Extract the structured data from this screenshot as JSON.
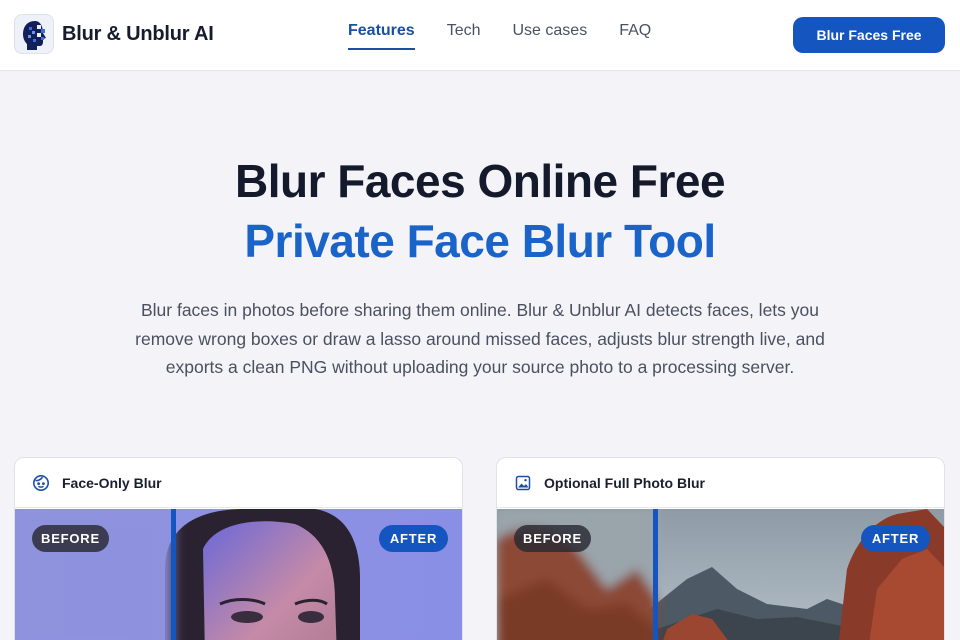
{
  "header": {
    "brand_name": "Blur & Unblur AI",
    "nav": [
      "Features",
      "Tech",
      "Use cases",
      "FAQ"
    ],
    "active_nav": "Features",
    "cta_label": "Blur Faces Free"
  },
  "hero": {
    "title": "Blur Faces Online Free",
    "subtitle": "Private Face Blur Tool",
    "description": "Blur faces in photos before sharing them online. Blur & Unblur AI detects faces, lets you remove wrong boxes or draw a lasso around missed faces, adjusts blur strength live, and exports a clean PNG without uploading your source photo to a processing server."
  },
  "cards": [
    {
      "title": "Face-Only Blur",
      "icon": "face-icon",
      "before_label": "BEFORE",
      "after_label": "AFTER"
    },
    {
      "title": "Optional Full Photo Blur",
      "icon": "image-icon",
      "before_label": "BEFORE",
      "after_label": "AFTER"
    }
  ],
  "colors": {
    "accent": "#1555c0",
    "accent_text": "#1a63c8",
    "background": "#f4f4f8",
    "title_text": "#141a2b"
  }
}
